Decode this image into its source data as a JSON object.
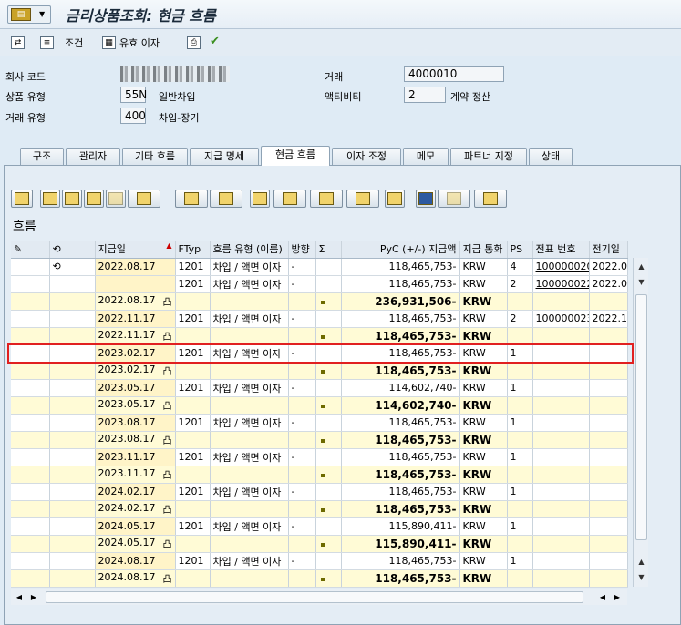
{
  "window": {
    "title": "금리상품조회: 현금 흐름"
  },
  "toolbar": {
    "items": [
      "조건",
      "유효 이자"
    ]
  },
  "header": {
    "company_code_label": "회사 코드",
    "product_type_label": "상품 유형",
    "product_type_code": "55N",
    "product_type_text": "일반차입",
    "trans_type_label": "거래 유형",
    "trans_type_code": "400",
    "trans_type_text": "차입-장기",
    "transaction_label": "거래",
    "transaction_value": "4000010",
    "activity_label": "액티비티",
    "activity_value": "2",
    "activity_text": "계약 정산"
  },
  "tabs": [
    "구조",
    "관리자",
    "기타 흐름",
    "지급 명세",
    "현금 흐름",
    "이자 조정",
    "메모",
    "파트너 지정",
    "상태"
  ],
  "active_tab": 4,
  "section_title": "흐름",
  "columns": [
    "",
    "",
    "지급일",
    "FTyp",
    "흐름 유형 (이름)",
    "방향",
    "Σ",
    "PyC (+/-) 지급액",
    "지급 통화",
    "PS",
    "전표 번호",
    "전기일"
  ],
  "rows": [
    {
      "t": "det",
      "date": "2022.08.17",
      "ftyp": "1201",
      "flow": "차입 / 액면 이자",
      "dir": "-",
      "amt": "118,465,753-",
      "cur": "KRW",
      "ps": "4",
      "doc": "100000020",
      "post": "2022.0"
    },
    {
      "t": "det",
      "date": "",
      "ftyp": "1201",
      "flow": "차입 / 액면 이자",
      "dir": "-",
      "amt": "118,465,753-",
      "cur": "KRW",
      "ps": "2",
      "doc": "100000022",
      "post": "2022.0"
    },
    {
      "t": "sub",
      "date": "2022.08.17",
      "amt": "236,931,506-",
      "cur": "KRW"
    },
    {
      "t": "det",
      "date": "2022.11.17",
      "ftyp": "1201",
      "flow": "차입 / 액면 이자",
      "dir": "-",
      "amt": "118,465,753-",
      "cur": "KRW",
      "ps": "2",
      "doc": "100000023",
      "post": "2022.1"
    },
    {
      "t": "sub",
      "date": "2022.11.17",
      "amt": "118,465,753-",
      "cur": "KRW"
    },
    {
      "t": "det",
      "date": "2023.02.17",
      "ftyp": "1201",
      "flow": "차입 / 액면 이자",
      "dir": "-",
      "amt": "118,465,753-",
      "cur": "KRW",
      "ps": "1",
      "doc": "",
      "post": ""
    },
    {
      "t": "sub",
      "date": "2023.02.17",
      "amt": "118,465,753-",
      "cur": "KRW"
    },
    {
      "t": "det",
      "date": "2023.05.17",
      "ftyp": "1201",
      "flow": "차입 / 액면 이자",
      "dir": "-",
      "amt": "114,602,740-",
      "cur": "KRW",
      "ps": "1",
      "doc": "",
      "post": ""
    },
    {
      "t": "sub",
      "date": "2023.05.17",
      "amt": "114,602,740-",
      "cur": "KRW"
    },
    {
      "t": "det",
      "date": "2023.08.17",
      "ftyp": "1201",
      "flow": "차입 / 액면 이자",
      "dir": "-",
      "amt": "118,465,753-",
      "cur": "KRW",
      "ps": "1",
      "doc": "",
      "post": ""
    },
    {
      "t": "sub",
      "date": "2023.08.17",
      "amt": "118,465,753-",
      "cur": "KRW"
    },
    {
      "t": "det",
      "date": "2023.11.17",
      "ftyp": "1201",
      "flow": "차입 / 액면 이자",
      "dir": "-",
      "amt": "118,465,753-",
      "cur": "KRW",
      "ps": "1",
      "doc": "",
      "post": ""
    },
    {
      "t": "sub",
      "date": "2023.11.17",
      "amt": "118,465,753-",
      "cur": "KRW"
    },
    {
      "t": "det",
      "date": "2024.02.17",
      "ftyp": "1201",
      "flow": "차입 / 액면 이자",
      "dir": "-",
      "amt": "118,465,753-",
      "cur": "KRW",
      "ps": "1",
      "doc": "",
      "post": ""
    },
    {
      "t": "sub",
      "date": "2024.02.17",
      "amt": "118,465,753-",
      "cur": "KRW"
    },
    {
      "t": "det",
      "date": "2024.05.17",
      "ftyp": "1201",
      "flow": "차입 / 액면 이자",
      "dir": "-",
      "amt": "115,890,411-",
      "cur": "KRW",
      "ps": "1",
      "doc": "",
      "post": ""
    },
    {
      "t": "sub",
      "date": "2024.05.17",
      "amt": "115,890,411-",
      "cur": "KRW"
    },
    {
      "t": "det",
      "date": "2024.08.17",
      "ftyp": "1201",
      "flow": "차입 / 액면 이자",
      "dir": "-",
      "amt": "118,465,753-",
      "cur": "KRW",
      "ps": "1",
      "doc": "",
      "post": ""
    },
    {
      "t": "sub",
      "date": "2024.08.17",
      "amt": "118,465,753-",
      "cur": "KRW"
    }
  ]
}
